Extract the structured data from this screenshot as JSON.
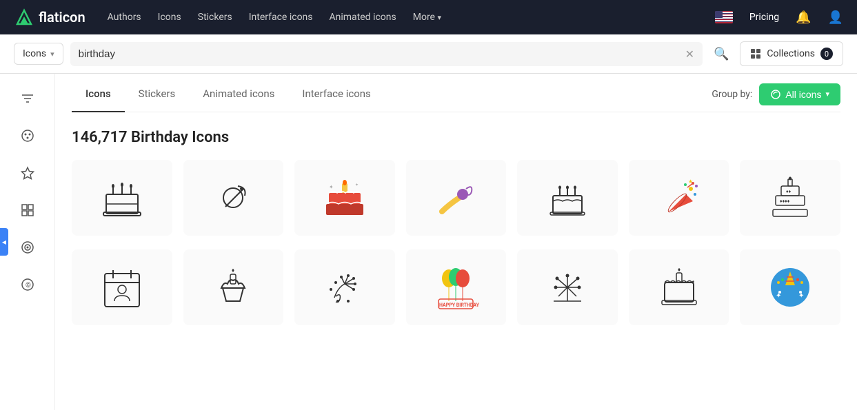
{
  "brand": {
    "name": "flaticon",
    "logo_emoji": "🔺"
  },
  "nav": {
    "links": [
      {
        "label": "Authors",
        "id": "authors",
        "has_arrow": false
      },
      {
        "label": "Icons",
        "id": "icons",
        "has_arrow": false
      },
      {
        "label": "Stickers",
        "id": "stickers",
        "has_arrow": false
      },
      {
        "label": "Interface icons",
        "id": "interface-icons",
        "has_arrow": false
      },
      {
        "label": "Animated icons",
        "id": "animated-icons",
        "has_arrow": false
      },
      {
        "label": "More",
        "id": "more",
        "has_arrow": true
      }
    ],
    "pricing_label": "Pricing"
  },
  "search": {
    "type_label": "Icons",
    "placeholder": "birthday",
    "value": "birthday",
    "collections_label": "Collections",
    "collections_count": "0"
  },
  "tabs": [
    {
      "label": "Icons",
      "id": "icons-tab",
      "active": true
    },
    {
      "label": "Stickers",
      "id": "stickers-tab",
      "active": false
    },
    {
      "label": "Animated icons",
      "id": "animated-icons-tab",
      "active": false
    },
    {
      "label": "Interface icons",
      "id": "interface-icons-tab",
      "active": false
    }
  ],
  "group_by": {
    "label": "Group by:",
    "button_label": "All icons"
  },
  "page_title": "146,717 Birthday Icons",
  "sidebar_items": [
    {
      "id": "filter",
      "icon": "⚙"
    },
    {
      "id": "style",
      "icon": "◎"
    },
    {
      "id": "star",
      "icon": "★"
    },
    {
      "id": "grid",
      "icon": "⊞"
    },
    {
      "id": "target",
      "icon": "⊙"
    },
    {
      "id": "copyright",
      "icon": "©"
    }
  ],
  "icons": [
    {
      "id": 1,
      "type": "birthday-cake-outline"
    },
    {
      "id": 2,
      "type": "party-horn"
    },
    {
      "id": 3,
      "type": "birthday-cake-color"
    },
    {
      "id": 4,
      "type": "party-blower"
    },
    {
      "id": 5,
      "type": "birthday-cake-simple"
    },
    {
      "id": 6,
      "type": "party-popper"
    },
    {
      "id": 7,
      "type": "tiered-cake"
    },
    {
      "id": 8,
      "type": "birthday-calendar"
    },
    {
      "id": 9,
      "type": "birthday-cupcake"
    },
    {
      "id": 10,
      "type": "confetti"
    },
    {
      "id": 11,
      "type": "happy-birthday-balloons"
    },
    {
      "id": 12,
      "type": "fireworks"
    },
    {
      "id": 13,
      "type": "cake-candle"
    },
    {
      "id": 14,
      "type": "birthday-circle"
    }
  ]
}
